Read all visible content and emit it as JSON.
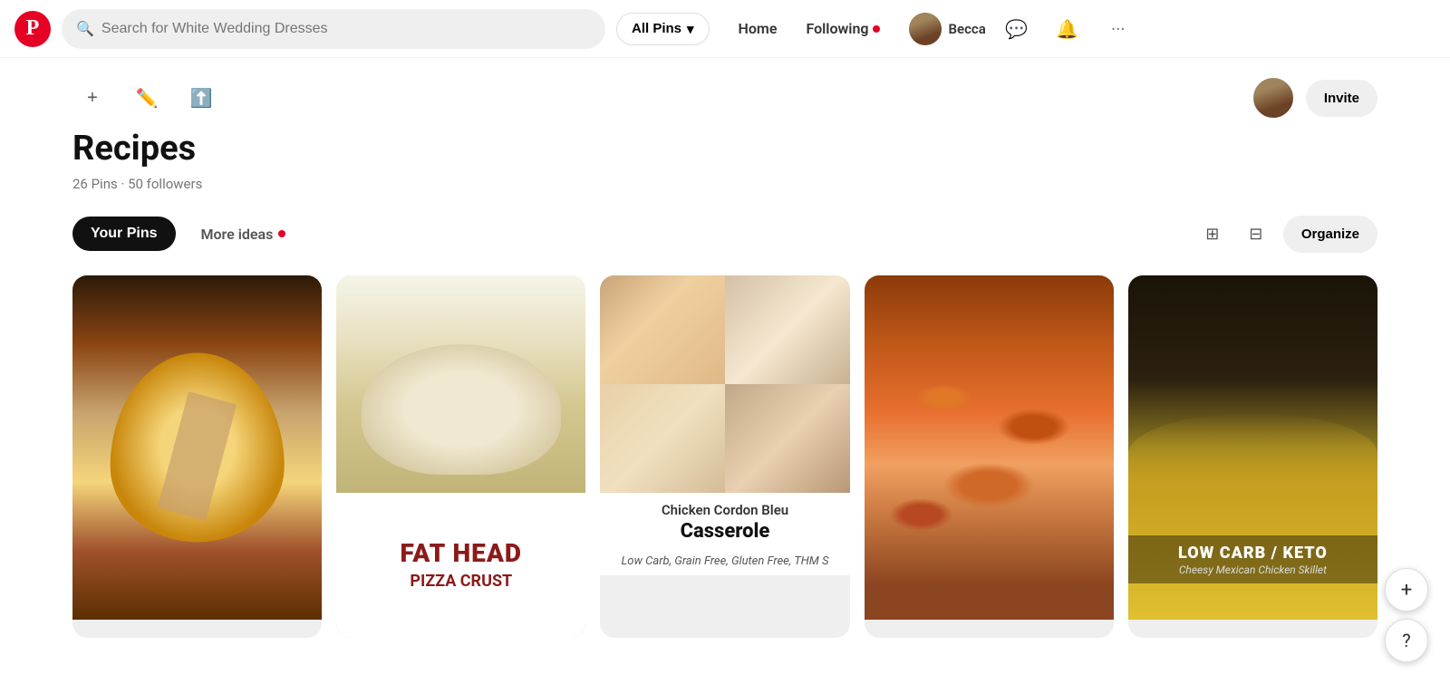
{
  "header": {
    "logo_label": "P",
    "search_placeholder": "Search for White Wedding Dresses",
    "all_pins_label": "All Pins",
    "home_label": "Home",
    "following_label": "Following",
    "username": "Becca",
    "messages_icon": "💬",
    "notifications_icon": "🔔",
    "more_icon": "···"
  },
  "board": {
    "invite_label": "Invite",
    "add_icon": "+",
    "edit_icon": "✏",
    "share_icon": "⬆",
    "title": "Recipes",
    "pins_count": "26 Pins",
    "followers_count": "50 followers",
    "meta": "26 Pins · 50 followers"
  },
  "tabs": {
    "your_pins": "Your Pins",
    "more_ideas": "More ideas",
    "organize": "Organize"
  },
  "pins": [
    {
      "id": "spaghetti-squash",
      "alt": "Spaghetti squash with cheese",
      "type": "spaghetti"
    },
    {
      "id": "fat-head-pizza",
      "alt": "Fat Head Pizza Crust",
      "type": "fathead",
      "text_title": "FAT HEAD",
      "text_sub": "PIZZA CRUST"
    },
    {
      "id": "chicken-cordon-bleu",
      "alt": "Chicken Cordon Bleu Casserole",
      "type": "chicken",
      "main_title": "Chicken Cordon Bleu",
      "dish_title": "Casserole",
      "subtitle": "Low Carb, Grain Free,\nGluten Free, THM S"
    },
    {
      "id": "bacon-casserole",
      "alt": "Bacon cheese casserole",
      "type": "bacon"
    },
    {
      "id": "keto-skillet",
      "alt": "Low Carb Keto Cheesy Mexican Chicken Skillet",
      "type": "keto",
      "title": "LOW CARB / KETO",
      "subtitle": "Cheesy Mexican Chicken Skillet"
    }
  ],
  "float": {
    "add_label": "+",
    "help_label": "?"
  }
}
